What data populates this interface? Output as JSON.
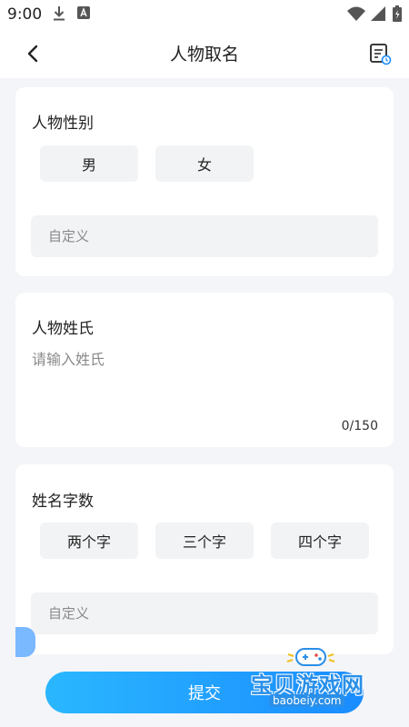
{
  "status_bar": {
    "time": "9:00"
  },
  "header": {
    "title": "人物取名"
  },
  "gender_card": {
    "title": "人物性别",
    "options": [
      "男",
      "女"
    ],
    "custom_placeholder": "自定义"
  },
  "surname_card": {
    "title": "人物姓氏",
    "placeholder": "请输入姓氏",
    "counter": "0/150"
  },
  "length_card": {
    "title": "姓名字数",
    "options": [
      "两个字",
      "三个字",
      "四个字"
    ],
    "custom_placeholder": "自定义"
  },
  "submit_label": "提交",
  "watermark": {
    "text": "宝贝游戏网",
    "domain": "baobeiy.com"
  },
  "colors": {
    "accent": "#1a8cff",
    "card_bg": "#ffffff",
    "page_bg": "#f4f5f8",
    "option_bg": "#f2f3f5"
  }
}
